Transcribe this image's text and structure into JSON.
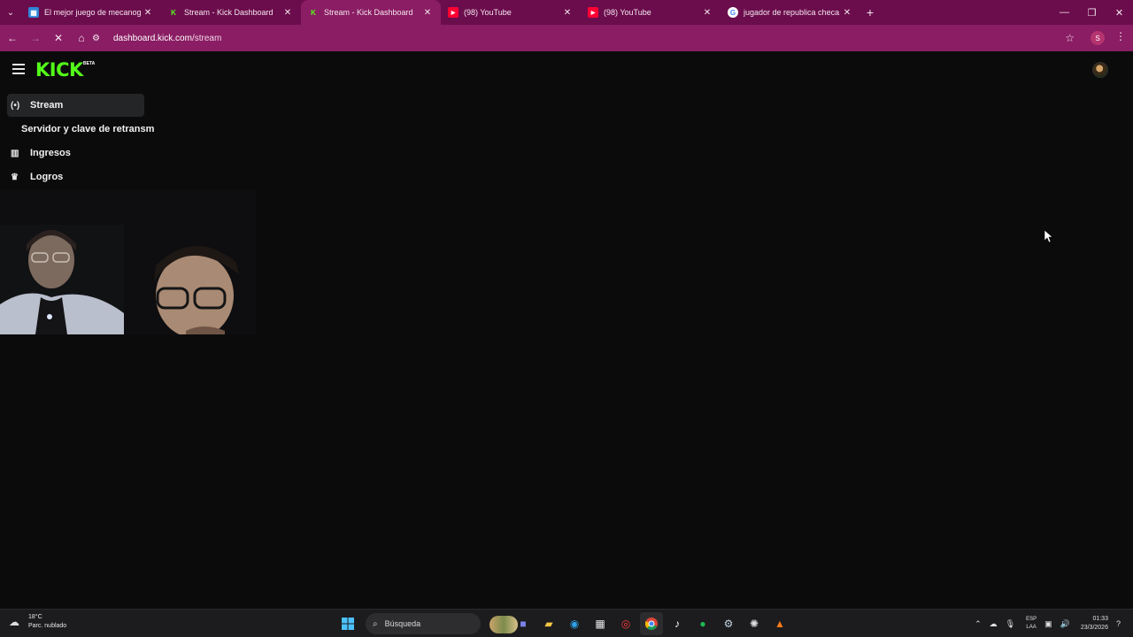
{
  "browser": {
    "tabs": [
      {
        "title": "El mejor juego de mecanografía",
        "favicon": "keyboard-favicon",
        "active": false
      },
      {
        "title": "Stream - Kick Dashboard",
        "favicon": "kick-favicon",
        "active": false
      },
      {
        "title": "Stream - Kick Dashboard",
        "favicon": "kick-favicon",
        "active": true
      },
      {
        "title": "(98) YouTube",
        "favicon": "youtube-favicon",
        "active": false
      },
      {
        "title": "(98) YouTube",
        "favicon": "youtube-favicon",
        "active": false
      },
      {
        "title": "jugador de republica checa - B",
        "favicon": "google-favicon",
        "active": false
      }
    ],
    "close_glyph": "✕",
    "new_tab_glyph": "+",
    "url_host": "dashboard.kick.com",
    "url_path": "/stream",
    "profile_initial": "S",
    "accent_color": "#8a1d63"
  },
  "app": {
    "logo_text": "KICK",
    "logo_badge": "BETA",
    "brand_color": "#53fc18"
  },
  "sidebar": {
    "items": [
      {
        "label": "Stream",
        "icon": "broadcast-icon",
        "active": true
      },
      {
        "label": "Servidor y clave de retransm",
        "icon": "",
        "active": false
      },
      {
        "label": "Ingresos",
        "icon": "bar-chart-icon",
        "active": false
      },
      {
        "label": "Logros",
        "icon": "trophy-icon",
        "active": false
      }
    ]
  },
  "taskbar": {
    "weather_temp": "18°C",
    "weather_desc": "Parc. nublado",
    "search_placeholder": "Búsqueda",
    "lang_top": "ESP",
    "lang_bottom": "LAA",
    "time": "01:33",
    "date": "23/3/2026"
  }
}
